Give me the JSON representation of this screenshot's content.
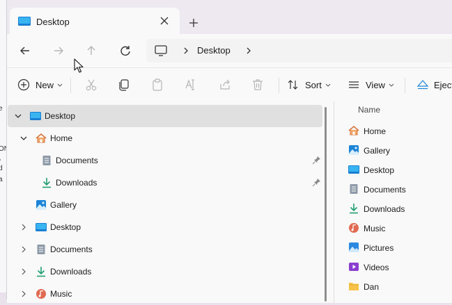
{
  "window": {
    "tab_title": "Desktop"
  },
  "background_fragments": [
    "e",
    "ON",
    "\\",
    "d",
    "a"
  ],
  "address_bar": {
    "location": "Desktop"
  },
  "command_bar": {
    "new_label": "New",
    "sort_label": "Sort",
    "view_label": "View",
    "eject_label": "Eject"
  },
  "nav_pane": {
    "items": [
      {
        "label": "Desktop"
      },
      {
        "label": "Home"
      },
      {
        "label": "Documents"
      },
      {
        "label": "Downloads"
      },
      {
        "label": "Gallery"
      },
      {
        "label": "Desktop"
      },
      {
        "label": "Documents"
      },
      {
        "label": "Downloads"
      },
      {
        "label": "Music"
      }
    ]
  },
  "content": {
    "column_header": "Name",
    "items": [
      {
        "label": "Home"
      },
      {
        "label": "Gallery"
      },
      {
        "label": "Desktop"
      },
      {
        "label": "Documents"
      },
      {
        "label": "Downloads"
      },
      {
        "label": "Music"
      },
      {
        "label": "Pictures"
      },
      {
        "label": "Videos"
      },
      {
        "label": "Dan"
      }
    ]
  },
  "colors": {
    "accent": "#1c84d6",
    "download_green": "#1f9e6e",
    "folder_yellow": "#f6c24a",
    "selection": "#e0e0e0"
  },
  "icons": [
    "desktop-folder-icon",
    "close-icon",
    "plus-icon",
    "back-arrow-icon",
    "forward-arrow-icon",
    "up-arrow-icon",
    "refresh-icon",
    "this-pc-icon",
    "chevron-right-icon",
    "new-plus-icon",
    "cut-icon",
    "copy-icon",
    "paste-icon",
    "rename-icon",
    "share-icon",
    "delete-icon",
    "sort-icon",
    "view-icon",
    "eject-icon",
    "home-icon",
    "documents-icon",
    "downloads-icon",
    "gallery-icon",
    "music-icon",
    "pictures-icon",
    "videos-icon",
    "folder-icon",
    "pin-icon"
  ]
}
